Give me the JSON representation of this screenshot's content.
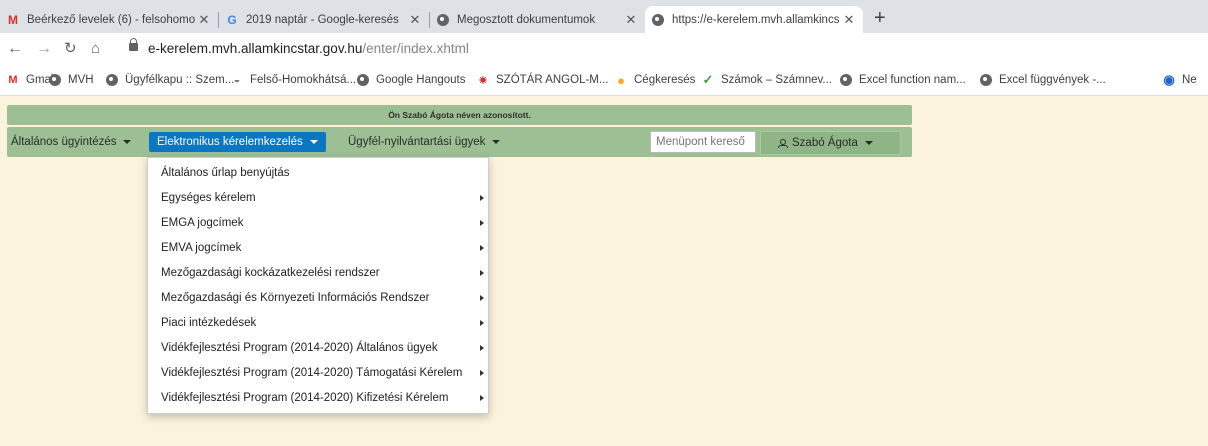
{
  "browser": {
    "tabs": [
      {
        "title": "Beérkező levelek (6) - felsohomo",
        "favicon": "M"
      },
      {
        "title": "2019 naptár - Google-keresés",
        "favicon": "G"
      },
      {
        "title": "Megosztott dokumentumok",
        "favicon": "globe"
      },
      {
        "title": "https://e-kerelem.mvh.allamkincs",
        "favicon": "globe"
      }
    ],
    "new_tab": "+",
    "url_host": "e-kerelem.mvh.allamkincstar.gov.hu",
    "url_path": "/enter/index.xhtml",
    "bookmarks": [
      "Gmail",
      "MVH",
      "Ügyfélkapu :: Szem...",
      "Felső-Homokhátsá...",
      "Google Hangouts",
      "SZÓTÁR ANGOL-M...",
      "Cégkeresés",
      "Számok – Számnev...",
      "Excel function nam...",
      "Excel függvények -...",
      "Ne"
    ]
  },
  "page": {
    "identity_notice": "Ön Szabó Ágota néven azonosított.",
    "menu": {
      "general": "Általános ügyintézés",
      "electronic": "Elektronikus kérelemkezelés",
      "client": "Ügyfél-nyilvántartási ügyek",
      "search_placeholder": "Menüpont kereső",
      "user": "Szabó Ágota"
    },
    "dropdown": [
      "Általános űrlap benyújtás",
      "Egységes kérelem",
      "EMGA jogcímek",
      "EMVA jogcímek",
      "Mezőgazdasági kockázatkezelési rendszer",
      "Mezőgazdasági és Környezeti Információs Rendszer",
      "Piaci intézkedések",
      "Vidékfejlesztési Program (2014-2020) Általános ügyek",
      "Vidékfejlesztési Program (2014-2020) Támogatási Kérelem",
      "Vidékfejlesztési Program (2014-2020) Kifizetési Kérelem"
    ]
  },
  "colors": {
    "page_bg": "#fbf3dd",
    "menu_green": "#9dbf94",
    "active_blue": "#0b77c4"
  }
}
